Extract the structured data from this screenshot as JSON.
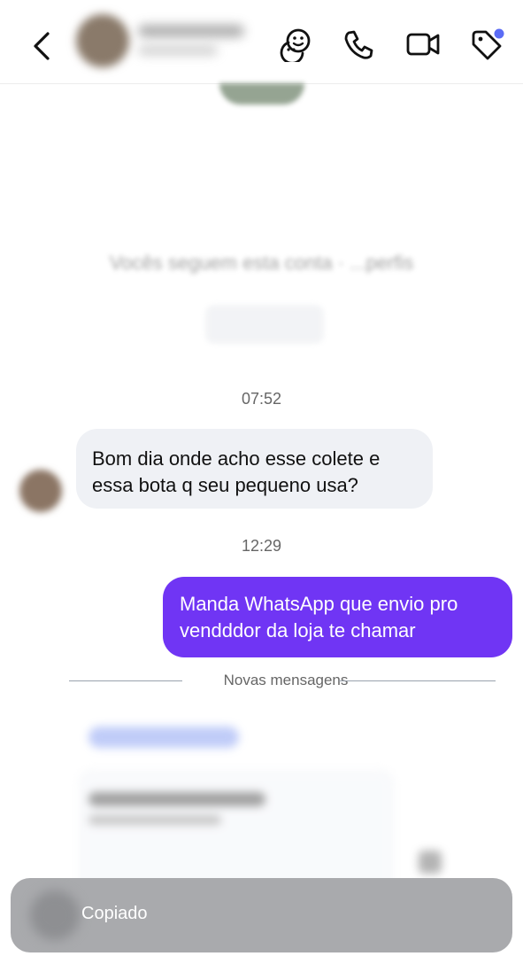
{
  "header": {
    "back_icon": "chevron-left-icon",
    "icons": [
      "sticker-icon",
      "phone-icon",
      "video-icon",
      "tag-icon"
    ],
    "tag_dot_color": "#5b6cf5"
  },
  "profile": {
    "blurred": true,
    "partial_line": "Vocês seguem esta conta · ...perfis"
  },
  "conversation": {
    "time1": "07:52",
    "incoming": "Bom dia onde acho esse colete e essa bota q seu pequeno usa?",
    "time2": "12:29",
    "outgoing": "Manda WhatsApp que envio pro vendddor da loja te chamar",
    "divider_label": "Novas mensagens"
  },
  "toast": {
    "text": "Copiado"
  },
  "colors": {
    "outgoing_bubble": "#7035f4",
    "incoming_bubble": "#eff1f5",
    "accent_dot": "#5b6cf5"
  }
}
